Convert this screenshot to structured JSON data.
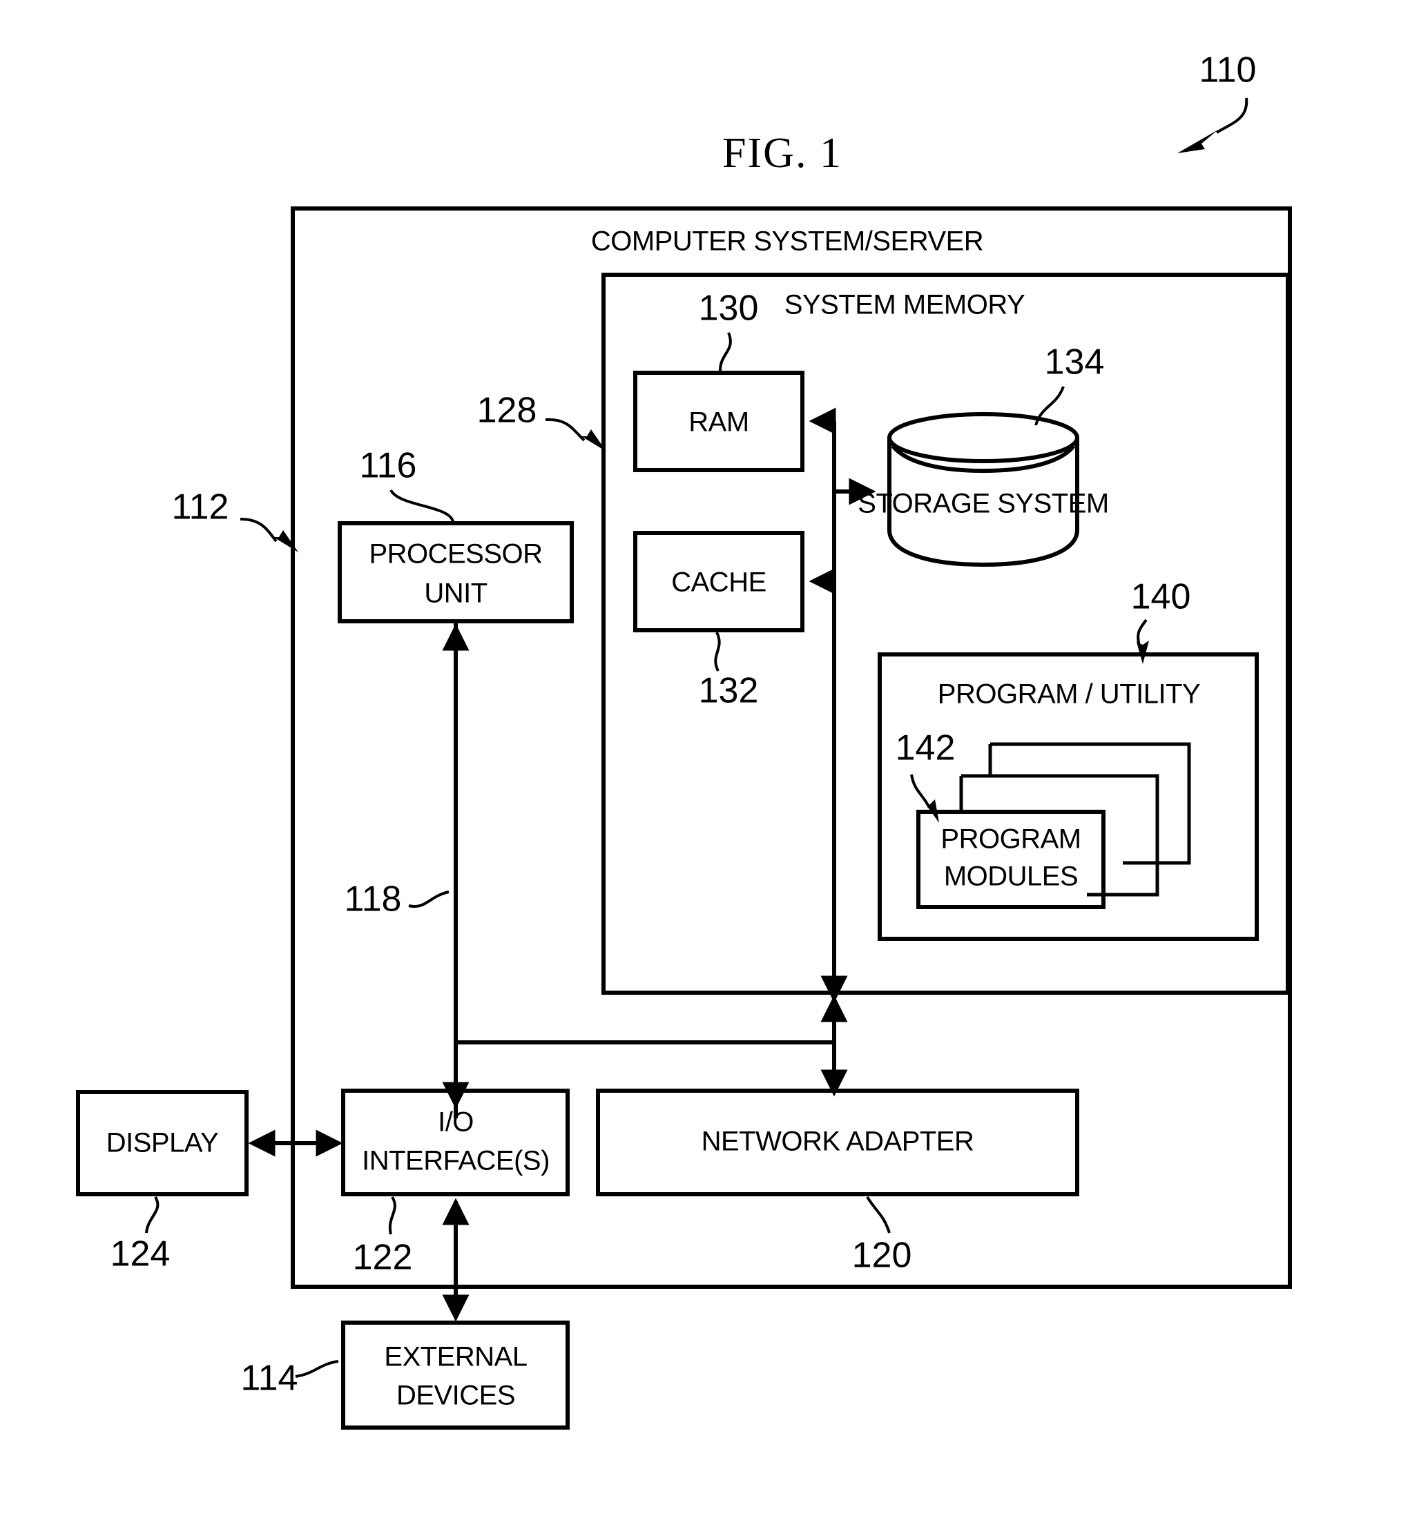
{
  "figure": {
    "title": "FIG. 1",
    "overall_ref": "110"
  },
  "outer_system": {
    "label": "COMPUTER SYSTEM/SERVER",
    "ref": "112"
  },
  "system_memory": {
    "label": "SYSTEM MEMORY",
    "ref": "128"
  },
  "blocks": {
    "processor": {
      "line1": "PROCESSOR",
      "line2": "UNIT",
      "ref": "116"
    },
    "ram": {
      "label": "RAM",
      "ref": "130"
    },
    "cache": {
      "label": "CACHE",
      "ref": "132"
    },
    "storage": {
      "label": "STORAGE SYSTEM",
      "ref": "134"
    },
    "program_utility": {
      "label": "PROGRAM / UTILITY",
      "ref": "140"
    },
    "program_modules": {
      "line1": "PROGRAM",
      "line2": "MODULES",
      "ref": "142"
    },
    "bus": {
      "ref": "118"
    },
    "io_interface": {
      "line1": "I/O",
      "line2": "INTERFACE(S)",
      "ref": "122"
    },
    "network_adapter": {
      "label": "NETWORK ADAPTER",
      "ref": "120"
    },
    "display": {
      "label": "DISPLAY",
      "ref": "124"
    },
    "external_devices": {
      "line1": "EXTERNAL",
      "line2": "DEVICES",
      "ref": "114"
    }
  },
  "colors": {
    "ink": "#000000",
    "paper": "#ffffff"
  }
}
